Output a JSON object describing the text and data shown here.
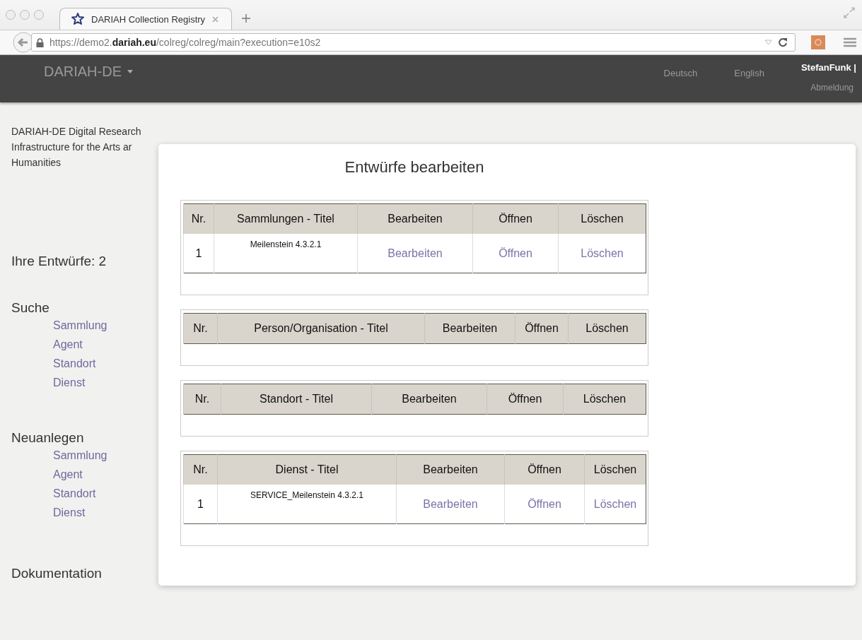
{
  "browser": {
    "tab_title": "DARIAH Collection Registry",
    "url": "https://demo2.**dariah.eu**/colreg/colreg/main?execution=e10s2"
  },
  "navbar": {
    "brand": "DARIAH-DE",
    "languages": [
      "Deutsch",
      "English"
    ],
    "user": "StefanFunk |",
    "logout": "Abmeldung"
  },
  "sidebar": {
    "intro": [
      "DARIAH-DE Digital Research",
      "Infrastructure for the Arts ar",
      "Humanities"
    ],
    "drafts": "Ihre Entwürfe: 2",
    "sections": [
      {
        "heading": "Suche",
        "links": [
          "Sammlung",
          "Agent",
          "Standort",
          "Dienst"
        ]
      },
      {
        "heading": "Neuanlegen",
        "links": [
          "Sammlung",
          "Agent",
          "Standort",
          "Dienst"
        ]
      }
    ],
    "footer_heading": "Dokumentation"
  },
  "modal": {
    "title": "Entwürfe bearbeiten",
    "tables": [
      {
        "columns": [
          "Nr.",
          "Sammlungen - Titel",
          "Bearbeiten",
          "Öffnen",
          "Löschen"
        ],
        "rows": [
          {
            "nr": "1",
            "title": "Meilenstein 4.3.2.1",
            "actions": [
              "Bearbeiten",
              "Öffnen",
              "Löschen"
            ]
          }
        ]
      },
      {
        "columns": [
          "Nr.",
          "Person/Organisation - Titel",
          "Bearbeiten",
          "Öffnen",
          "Löschen"
        ]
      },
      {
        "columns": [
          "Nr.",
          "Standort - Titel",
          "Bearbeiten",
          "Öffnen",
          "Löschen"
        ]
      },
      {
        "columns": [
          "Nr.",
          "Dienst - Titel",
          "Bearbeiten",
          "Öffnen",
          "Löschen"
        ],
        "rows": [
          {
            "nr": "1",
            "title": "SERVICE_Meilenstein 4.3.2.1",
            "actions": [
              "Bearbeiten",
              "Öffnen",
              "Löschen"
            ]
          }
        ]
      }
    ]
  }
}
